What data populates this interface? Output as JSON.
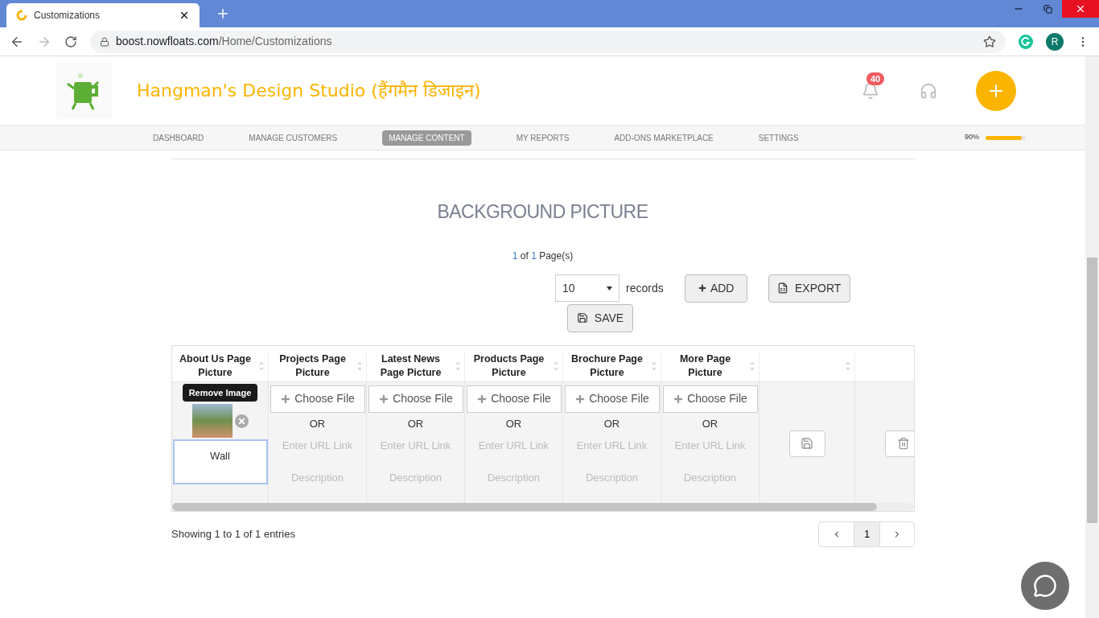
{
  "browser": {
    "tab_title": "Customizations",
    "url_host": "boost.nowfloats.com",
    "url_path": "/Home/Customizations",
    "avatar": "R"
  },
  "header": {
    "brand": "Hangman's Design Studio (हैंगमैन डिजाइन)",
    "notification_count": "40"
  },
  "nav": {
    "items": [
      {
        "label": "DASHBOARD",
        "selected": false
      },
      {
        "label": "MANAGE CUSTOMERS",
        "selected": false
      },
      {
        "label": "MANAGE CONTENT",
        "selected": true
      },
      {
        "label": "MY REPORTS",
        "selected": false
      },
      {
        "label": "ADD-ONS MARKETPLACE",
        "selected": false
      },
      {
        "label": "SETTINGS",
        "selected": false
      }
    ],
    "profile": {
      "reading": "90%",
      "level": 0.9
    }
  },
  "section_title": "BACKGROUND PICTURE",
  "page_info": {
    "current": "1",
    "of_text": "of",
    "total": "1",
    "suffix": "Page(s)"
  },
  "records": {
    "value": "10",
    "label": "records"
  },
  "buttons": {
    "add": "ADD",
    "export": "EXPORT",
    "save": "SAVE"
  },
  "table": {
    "columns": [
      {
        "label": "About Us Page Picture",
        "sortable": true
      },
      {
        "label": "Projects Page Picture",
        "sortable": true
      },
      {
        "label": "Latest News Page Picture",
        "sortable": true
      },
      {
        "label": "Products Page Picture",
        "sortable": true
      },
      {
        "label": "Brochure Page Picture",
        "sortable": true
      },
      {
        "label": "More Page Picture",
        "sortable": true
      },
      {
        "sortable": true
      }
    ],
    "row": {
      "image_cell": {
        "tooltip": "Remove Image",
        "description": "Wall"
      },
      "upload_cells": [
        {
          "choose": "Choose File",
          "or": "OR",
          "url_placeholder": "Enter URL Link",
          "description_placeholder": "Description"
        },
        {
          "choose": "Choose File",
          "or": "OR",
          "url_placeholder": "Enter URL Link",
          "description_placeholder": "Description"
        },
        {
          "choose": "Choose File",
          "or": "OR",
          "url_placeholder": "Enter URL Link",
          "description_placeholder": "Description"
        },
        {
          "choose": "Choose File",
          "or": "OR",
          "url_placeholder": "Enter URL Link",
          "description_placeholder": "Description"
        },
        {
          "choose": "Choose File",
          "or": "OR",
          "url_placeholder": "Enter URL Link",
          "description_placeholder": "Description"
        }
      ]
    }
  },
  "footer": {
    "entries": "Showing 1 to 1 of 1 entries",
    "pages": [
      {
        "label": "1",
        "selected": true
      }
    ]
  }
}
